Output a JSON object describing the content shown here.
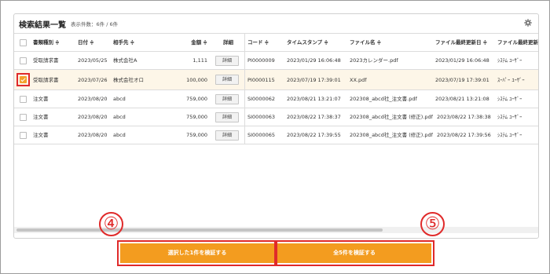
{
  "panel": {
    "title": "検索結果一覧",
    "count": "表示件数：6件 / 6件",
    "settings_icon": "gear-icon"
  },
  "table": {
    "headers": [
      "書類種別 ≑",
      "日付 ≑",
      "相手先 ≑",
      "金額 ≑",
      "詳細",
      "コード ≑",
      "タイムスタンプ ≑",
      "ファイル名 ≑",
      "ファイル最終更新日 ≑",
      "ファイル最終更新"
    ],
    "detail_label": "詳細",
    "rows": [
      {
        "type": "受取請求書",
        "date": "2023/05/25",
        "partner": "株式会社A",
        "amount": "1,111",
        "code": "PI0000009",
        "timestamp": "2023/01/29 16:06:48",
        "filename": "2023カレンダー.pdf",
        "updated": "2023/01/29 16:06:48",
        "updater": "ｼｽﾃﾑ ﾕｰｻﾞｰ",
        "checked": false
      },
      {
        "type": "受取請求書",
        "date": "2023/07/26",
        "partner": "株式会社オロ",
        "amount": "100,000",
        "code": "PI0000115",
        "timestamp": "2023/07/19 17:39:01",
        "filename": "XX.pdf",
        "updated": "2023/07/19 17:39:01",
        "updater": "ｽｰﾊﾟｰ ﾕｰｻﾞｰ",
        "checked": true
      },
      {
        "type": "注文書",
        "date": "2023/08/20",
        "partner": "abcd",
        "amount": "759,000",
        "code": "SI0000062",
        "timestamp": "2023/08/21 13:21:07",
        "filename": "202308_abcd社_注文書.pdf",
        "updated": "2023/08/21 13:21:08",
        "updater": "ｼｽﾃﾑ ﾕｰｻﾞｰ",
        "checked": false
      },
      {
        "type": "注文書",
        "date": "2023/08/20",
        "partner": "abcd",
        "amount": "759,000",
        "code": "SI0000063",
        "timestamp": "2023/08/22 17:38:37",
        "filename": "202308_abcd社_注文書 (修正).pdf",
        "updated": "2023/08/22 17:38:38",
        "updater": "ｼｽﾃﾑ ﾕｰｻﾞｰ",
        "checked": false
      },
      {
        "type": "注文書",
        "date": "2023/08/20",
        "partner": "abcd",
        "amount": "759,000",
        "code": "SI0000065",
        "timestamp": "2023/08/22 17:39:55",
        "filename": "202308_abcd社_注文書 (修正).pdf",
        "updated": "2023/08/22 17:39:56",
        "updater": "ｼｽﾃﾑ ﾕｰｻﾞｰ",
        "checked": false
      }
    ]
  },
  "actions": {
    "verify_selected": "選択した1件を検証する",
    "verify_all": "全5件を検証する"
  },
  "markers": {
    "four": "④",
    "five": "⑤"
  },
  "colors": {
    "accent": "#f39c1f",
    "highlight": "#e02a2a",
    "selected_row": "#fdf6e8"
  }
}
